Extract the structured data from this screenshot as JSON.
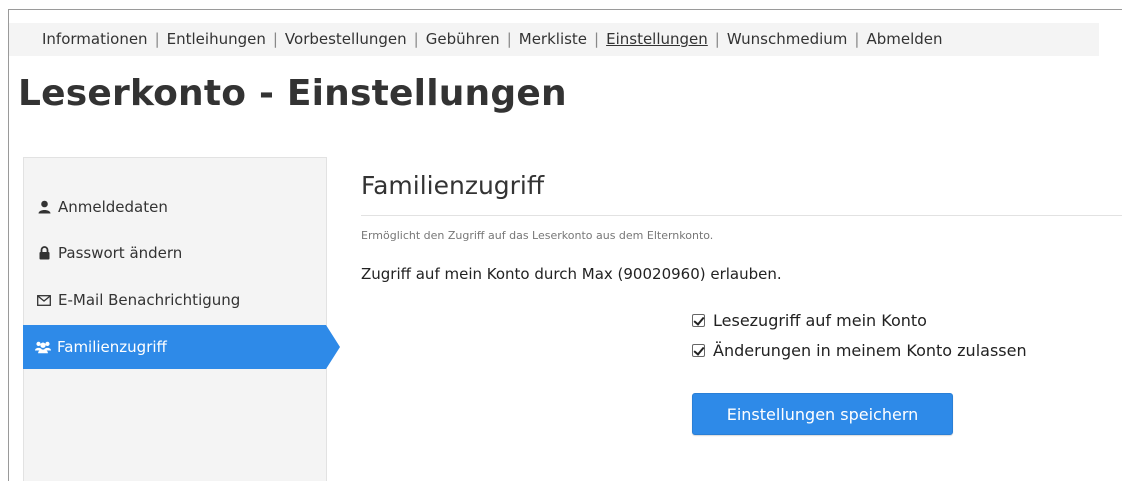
{
  "nav": {
    "items": [
      {
        "label": "Informationen"
      },
      {
        "label": "Entleihungen"
      },
      {
        "label": "Vorbestellungen"
      },
      {
        "label": "Gebühren"
      },
      {
        "label": "Merkliste"
      },
      {
        "label": "Einstellungen",
        "active": true
      },
      {
        "label": "Wunschmedium"
      },
      {
        "label": "Abmelden"
      }
    ],
    "separator": "|"
  },
  "page": {
    "title": "Leserkonto - Einstellungen"
  },
  "sidebar": {
    "items": [
      {
        "label": "Anmeldedaten",
        "icon": "user-icon"
      },
      {
        "label": "Passwort ändern",
        "icon": "lock-icon"
      },
      {
        "label": "E-Mail Benachrichtigung",
        "icon": "envelope-icon"
      },
      {
        "label": "Familienzugriff",
        "icon": "users-icon",
        "active": true
      }
    ]
  },
  "main": {
    "title": "Familienzugriff",
    "description": "Ermöglicht den Zugriff auf das Leserkonto aus dem Elternkonto.",
    "access_text": "Zugriff auf mein Konto durch Max (90020960) erlauben.",
    "checkboxes": [
      {
        "label": "Lesezugriff auf mein Konto",
        "checked": true
      },
      {
        "label": "Änderungen in meinem Konto zulassen",
        "checked": true
      }
    ],
    "save_label": "Einstellungen speichern"
  },
  "colors": {
    "accent": "#2e8ae8",
    "sidebar_bg": "#f4f4f4",
    "nav_bg": "#f4f4f4"
  }
}
